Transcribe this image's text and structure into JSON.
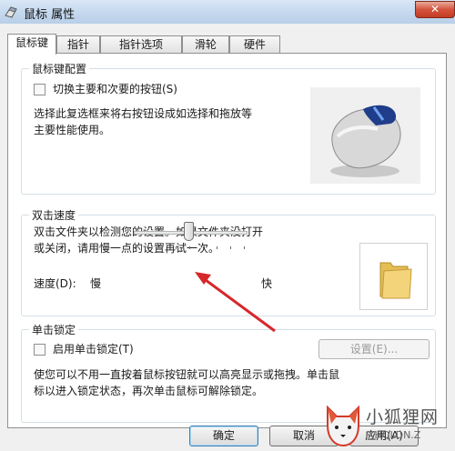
{
  "window": {
    "title": "鼠标 属性",
    "close_symbol": "✕"
  },
  "tabs": [
    {
      "label": "鼠标键",
      "active": true
    },
    {
      "label": "指针",
      "active": false
    },
    {
      "label": "指针选项",
      "active": false
    },
    {
      "label": "滑轮",
      "active": false
    },
    {
      "label": "硬件",
      "active": false
    }
  ],
  "button_config": {
    "title": "鼠标键配置",
    "switch_label": "切换主要和次要的按钮(S)",
    "switch_checked": false,
    "desc_line1": "选择此复选框来将右按钮设成如选择和拖放等",
    "desc_line2": "主要性能使用。"
  },
  "double_click": {
    "title": "双击速度",
    "desc_line1": "双击文件夹以检测您的设置。如果文件夹没打开",
    "desc_line2": "或关闭，请用慢一点的设置再试一次。",
    "speed_label": "速度(D):",
    "slow_label": "慢",
    "fast_label": "快",
    "speed_level": 0.5
  },
  "click_lock": {
    "title": "单击锁定",
    "enable_label": "启用单击锁定(T)",
    "enable_checked": false,
    "settings_label": "设置(E)...",
    "desc_line1": "使您可以不用一直按着鼠标按钮就可以高亮显示或拖拽。单击鼠",
    "desc_line2": "标以进入锁定状态，再次单击鼠标可解除锁定。"
  },
  "footer": {
    "ok_label": "确定",
    "cancel_label": "取消",
    "apply_label": "应用(A)"
  },
  "watermark": {
    "text_top": "小狐狸网",
    "text_bottom": "XHQLDN.Z"
  },
  "colors": {
    "title_bar": "#c4d8ee",
    "close_button": "#c9442b",
    "arrow": "#d6282a",
    "panel": "#ffffff"
  }
}
